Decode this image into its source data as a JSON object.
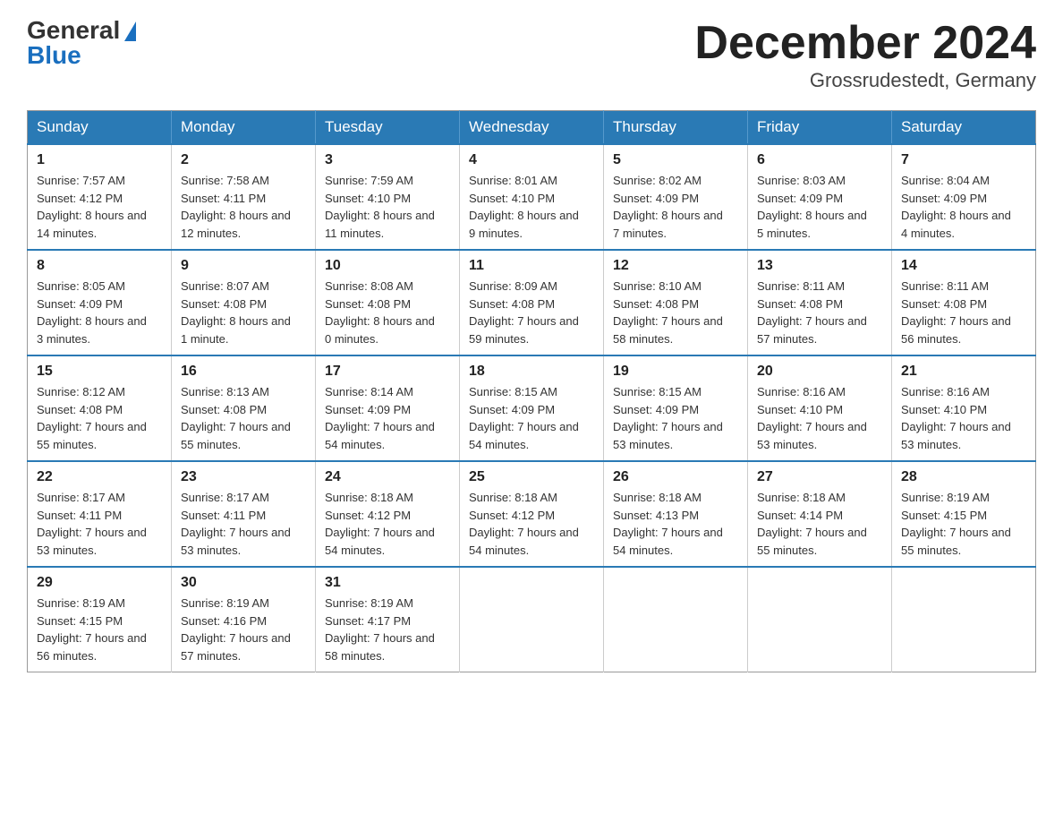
{
  "logo": {
    "general": "General",
    "blue": "Blue"
  },
  "title": "December 2024",
  "location": "Grossrudestedt, Germany",
  "days_of_week": [
    "Sunday",
    "Monday",
    "Tuesday",
    "Wednesday",
    "Thursday",
    "Friday",
    "Saturday"
  ],
  "weeks": [
    [
      {
        "day": "1",
        "sunrise": "7:57 AM",
        "sunset": "4:12 PM",
        "daylight": "8 hours and 14 minutes."
      },
      {
        "day": "2",
        "sunrise": "7:58 AM",
        "sunset": "4:11 PM",
        "daylight": "8 hours and 12 minutes."
      },
      {
        "day": "3",
        "sunrise": "7:59 AM",
        "sunset": "4:10 PM",
        "daylight": "8 hours and 11 minutes."
      },
      {
        "day": "4",
        "sunrise": "8:01 AM",
        "sunset": "4:10 PM",
        "daylight": "8 hours and 9 minutes."
      },
      {
        "day": "5",
        "sunrise": "8:02 AM",
        "sunset": "4:09 PM",
        "daylight": "8 hours and 7 minutes."
      },
      {
        "day": "6",
        "sunrise": "8:03 AM",
        "sunset": "4:09 PM",
        "daylight": "8 hours and 5 minutes."
      },
      {
        "day": "7",
        "sunrise": "8:04 AM",
        "sunset": "4:09 PM",
        "daylight": "8 hours and 4 minutes."
      }
    ],
    [
      {
        "day": "8",
        "sunrise": "8:05 AM",
        "sunset": "4:09 PM",
        "daylight": "8 hours and 3 minutes."
      },
      {
        "day": "9",
        "sunrise": "8:07 AM",
        "sunset": "4:08 PM",
        "daylight": "8 hours and 1 minute."
      },
      {
        "day": "10",
        "sunrise": "8:08 AM",
        "sunset": "4:08 PM",
        "daylight": "8 hours and 0 minutes."
      },
      {
        "day": "11",
        "sunrise": "8:09 AM",
        "sunset": "4:08 PM",
        "daylight": "7 hours and 59 minutes."
      },
      {
        "day": "12",
        "sunrise": "8:10 AM",
        "sunset": "4:08 PM",
        "daylight": "7 hours and 58 minutes."
      },
      {
        "day": "13",
        "sunrise": "8:11 AM",
        "sunset": "4:08 PM",
        "daylight": "7 hours and 57 minutes."
      },
      {
        "day": "14",
        "sunrise": "8:11 AM",
        "sunset": "4:08 PM",
        "daylight": "7 hours and 56 minutes."
      }
    ],
    [
      {
        "day": "15",
        "sunrise": "8:12 AM",
        "sunset": "4:08 PM",
        "daylight": "7 hours and 55 minutes."
      },
      {
        "day": "16",
        "sunrise": "8:13 AM",
        "sunset": "4:08 PM",
        "daylight": "7 hours and 55 minutes."
      },
      {
        "day": "17",
        "sunrise": "8:14 AM",
        "sunset": "4:09 PM",
        "daylight": "7 hours and 54 minutes."
      },
      {
        "day": "18",
        "sunrise": "8:15 AM",
        "sunset": "4:09 PM",
        "daylight": "7 hours and 54 minutes."
      },
      {
        "day": "19",
        "sunrise": "8:15 AM",
        "sunset": "4:09 PM",
        "daylight": "7 hours and 53 minutes."
      },
      {
        "day": "20",
        "sunrise": "8:16 AM",
        "sunset": "4:10 PM",
        "daylight": "7 hours and 53 minutes."
      },
      {
        "day": "21",
        "sunrise": "8:16 AM",
        "sunset": "4:10 PM",
        "daylight": "7 hours and 53 minutes."
      }
    ],
    [
      {
        "day": "22",
        "sunrise": "8:17 AM",
        "sunset": "4:11 PM",
        "daylight": "7 hours and 53 minutes."
      },
      {
        "day": "23",
        "sunrise": "8:17 AM",
        "sunset": "4:11 PM",
        "daylight": "7 hours and 53 minutes."
      },
      {
        "day": "24",
        "sunrise": "8:18 AM",
        "sunset": "4:12 PM",
        "daylight": "7 hours and 54 minutes."
      },
      {
        "day": "25",
        "sunrise": "8:18 AM",
        "sunset": "4:12 PM",
        "daylight": "7 hours and 54 minutes."
      },
      {
        "day": "26",
        "sunrise": "8:18 AM",
        "sunset": "4:13 PM",
        "daylight": "7 hours and 54 minutes."
      },
      {
        "day": "27",
        "sunrise": "8:18 AM",
        "sunset": "4:14 PM",
        "daylight": "7 hours and 55 minutes."
      },
      {
        "day": "28",
        "sunrise": "8:19 AM",
        "sunset": "4:15 PM",
        "daylight": "7 hours and 55 minutes."
      }
    ],
    [
      {
        "day": "29",
        "sunrise": "8:19 AM",
        "sunset": "4:15 PM",
        "daylight": "7 hours and 56 minutes."
      },
      {
        "day": "30",
        "sunrise": "8:19 AM",
        "sunset": "4:16 PM",
        "daylight": "7 hours and 57 minutes."
      },
      {
        "day": "31",
        "sunrise": "8:19 AM",
        "sunset": "4:17 PM",
        "daylight": "7 hours and 58 minutes."
      },
      null,
      null,
      null,
      null
    ]
  ],
  "labels": {
    "sunrise": "Sunrise:",
    "sunset": "Sunset:",
    "daylight": "Daylight:"
  }
}
